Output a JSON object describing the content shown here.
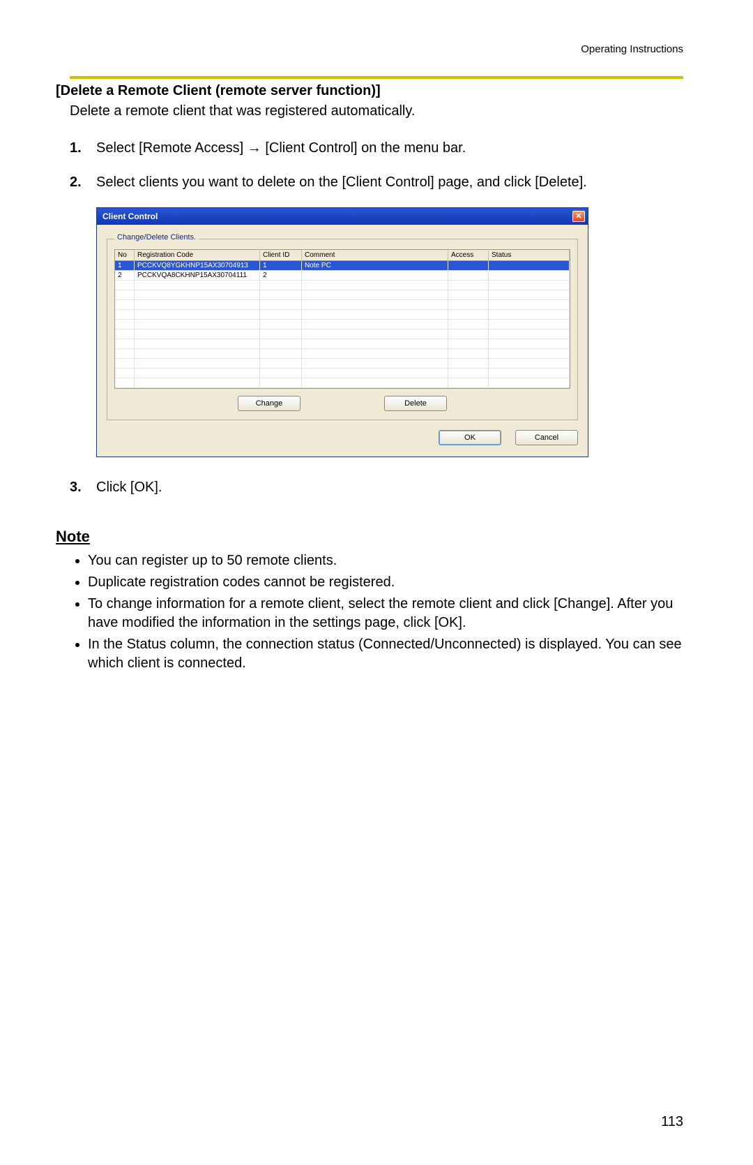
{
  "header": {
    "label": "Operating Instructions"
  },
  "section": {
    "title": "[Delete a Remote Client (remote server function)]",
    "intro": "Delete a remote client that was registered automatically."
  },
  "steps": [
    {
      "num": "1.",
      "text_before": "Select [Remote Access] ",
      "arrow": "→",
      "text_after": " [Client Control] on the menu bar."
    },
    {
      "num": "2.",
      "text": "Select clients you want to delete on the [Client Control] page, and click [Delete]."
    },
    {
      "num": "3.",
      "text": "Click [OK]."
    }
  ],
  "dialog": {
    "title": "Client Control",
    "group_legend": "Change/Delete Clients.",
    "columns": {
      "no": "No",
      "reg": "Registration Code",
      "cid": "Client ID",
      "comment": "Comment",
      "access": "Access",
      "status": "Status"
    },
    "rows": [
      {
        "no": "1",
        "reg": "PCCKVQ8YGKHNP15AX30704913",
        "cid": "1",
        "comment": "Note PC",
        "access": "",
        "status": ""
      },
      {
        "no": "2",
        "reg": "PCCKVQA8CKHNP15AX30704111",
        "cid": "2",
        "comment": "",
        "access": "",
        "status": ""
      }
    ],
    "buttons": {
      "change": "Change",
      "delete": "Delete",
      "ok": "OK",
      "cancel": "Cancel"
    }
  },
  "note": {
    "heading": "Note",
    "items": [
      "You can register up to 50 remote clients.",
      "Duplicate registration codes cannot be registered.",
      "To change information for a remote client, select the remote client and click [Change]. After you have modified the information in the settings page, click [OK].",
      "In the Status column, the connection status (Connected/Unconnected) is displayed. You can see which client is connected."
    ]
  },
  "page_number": "113"
}
